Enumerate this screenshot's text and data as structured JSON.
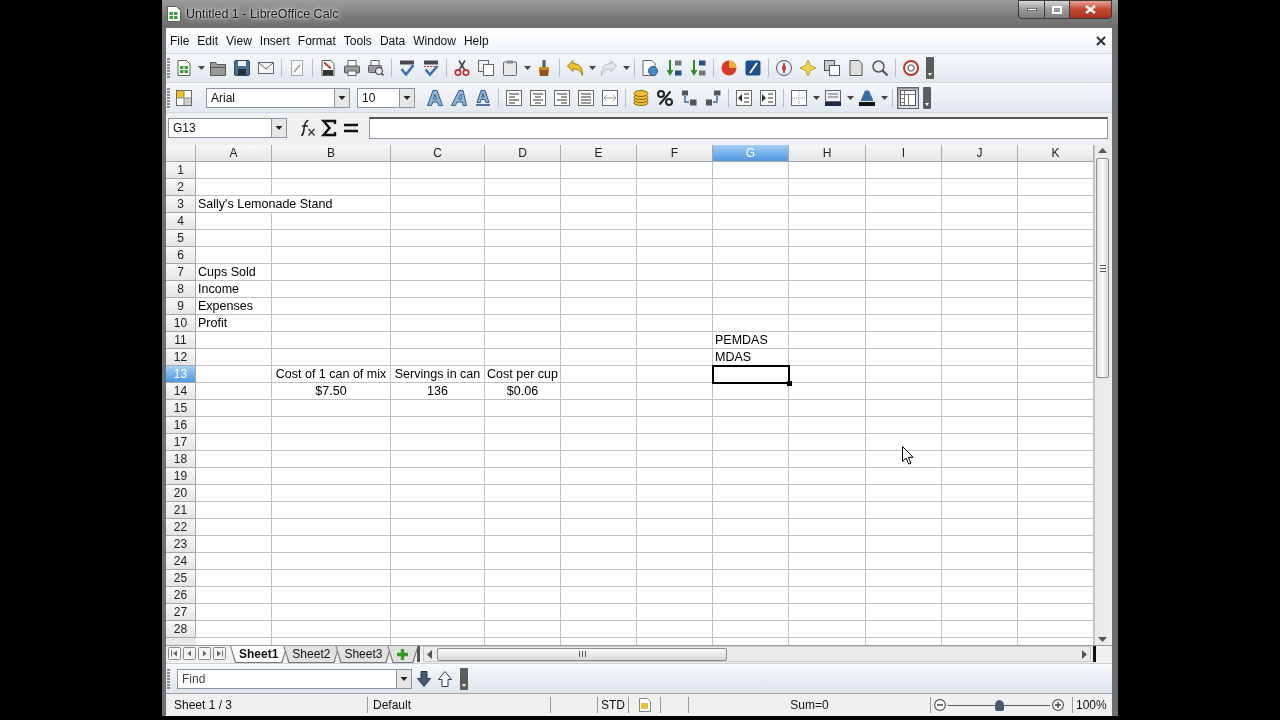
{
  "window": {
    "title": "Untitled 1 - LibreOffice Calc"
  },
  "menu_bar": [
    "File",
    "Edit",
    "View",
    "Insert",
    "Format",
    "Tools",
    "Data",
    "Window",
    "Help"
  ],
  "formatting_toolbar": {
    "font_name": "Arial",
    "font_size": "10",
    "grid_toggle": {
      "pressed": true
    }
  },
  "formula_bar": {
    "name_box": "G13"
  },
  "sheet": {
    "columns": [
      {
        "label": "A",
        "selected": false
      },
      {
        "label": "B",
        "selected": false
      },
      {
        "label": "C",
        "selected": false
      },
      {
        "label": "D",
        "selected": false
      },
      {
        "label": "E",
        "selected": false
      },
      {
        "label": "F",
        "selected": false
      },
      {
        "label": "G",
        "selected": true
      },
      {
        "label": "H",
        "selected": false
      },
      {
        "label": "I",
        "selected": false
      },
      {
        "label": "J",
        "selected": false
      },
      {
        "label": "K",
        "selected": false
      }
    ],
    "rows": [
      {
        "label": "1",
        "selected": false
      },
      {
        "label": "2",
        "selected": false
      },
      {
        "label": "3",
        "selected": false,
        "cells": {
          "A": {
            "text": "Sally's Lemonade Stand",
            "centered": false
          }
        }
      },
      {
        "label": "4",
        "selected": false
      },
      {
        "label": "5",
        "selected": false
      },
      {
        "label": "6",
        "selected": false
      },
      {
        "label": "7",
        "selected": false,
        "cells": {
          "A": {
            "text": "Cups Sold",
            "centered": false
          }
        }
      },
      {
        "label": "8",
        "selected": false,
        "cells": {
          "A": {
            "text": "Income",
            "centered": false
          }
        }
      },
      {
        "label": "9",
        "selected": false,
        "cells": {
          "A": {
            "text": "Expenses",
            "centered": false
          }
        }
      },
      {
        "label": "10",
        "selected": false,
        "cells": {
          "A": {
            "text": "Profit",
            "centered": false
          }
        }
      },
      {
        "label": "11",
        "selected": false,
        "cells": {
          "G": {
            "text": "PEMDAS",
            "centered": false
          }
        }
      },
      {
        "label": "12",
        "selected": false,
        "cells": {
          "G": {
            "text": "MDAS",
            "centered": false
          }
        }
      },
      {
        "label": "13",
        "selected": true,
        "cells": {
          "B": {
            "text": "Cost of 1 can of mix",
            "centered": true
          },
          "C": {
            "text": "Servings in can",
            "centered": true
          },
          "D": {
            "text": "Cost per cup",
            "centered": true
          }
        }
      },
      {
        "label": "14",
        "selected": false,
        "cells": {
          "B": {
            "text": "$7.50",
            "centered": true
          },
          "C": {
            "text": "136",
            "centered": true
          },
          "D": {
            "text": "$0.06",
            "centered": true
          }
        }
      },
      {
        "label": "15",
        "selected": false
      },
      {
        "label": "16",
        "selected": false
      },
      {
        "label": "17",
        "selected": false
      },
      {
        "label": "18",
        "selected": false
      },
      {
        "label": "19",
        "selected": false
      },
      {
        "label": "20",
        "selected": false
      },
      {
        "label": "21",
        "selected": false
      },
      {
        "label": "22",
        "selected": false
      },
      {
        "label": "23",
        "selected": false
      },
      {
        "label": "24",
        "selected": false
      },
      {
        "label": "25",
        "selected": false
      },
      {
        "label": "26",
        "selected": false
      },
      {
        "label": "27",
        "selected": false
      },
      {
        "label": "28",
        "selected": false
      }
    ]
  },
  "sheet_tabs": [
    {
      "label": "Sheet1",
      "selected": true
    },
    {
      "label": "Sheet2",
      "selected": false
    },
    {
      "label": "Sheet3",
      "selected": false
    }
  ],
  "find_bar": {
    "placeholder": "Find"
  },
  "status_bar": {
    "sheet": "Sheet 1 / 3",
    "page_style": "Default",
    "selection_mode": "STD",
    "sum": "Sum=0",
    "zoom": {
      "level": 0.5,
      "reading": "100%"
    }
  }
}
